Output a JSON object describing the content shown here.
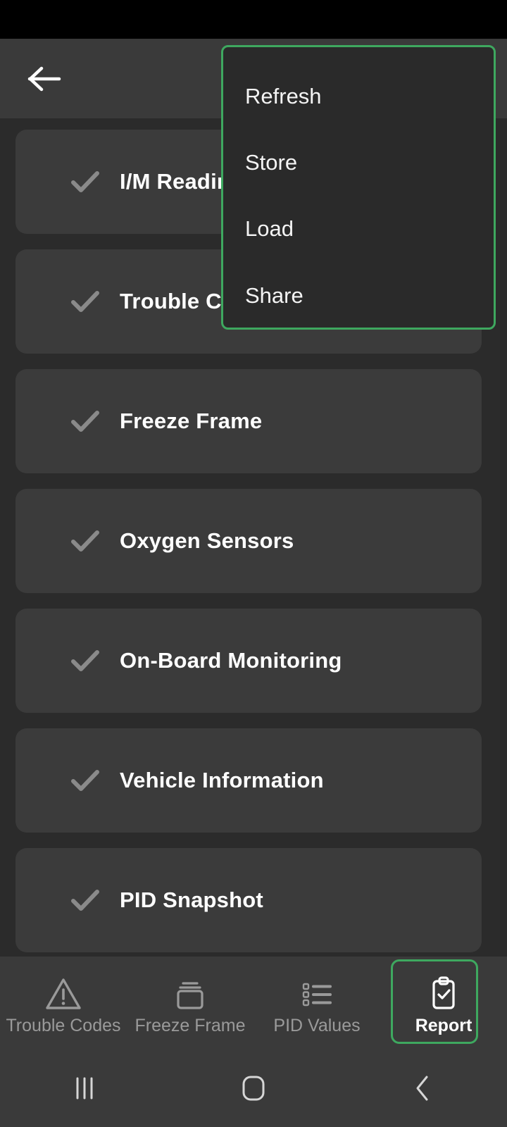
{
  "app_bar": {
    "back_icon": "arrow-left-icon"
  },
  "list": {
    "items": [
      {
        "label": "I/M Readiness",
        "check_icon": "check-icon",
        "checked": true
      },
      {
        "label": "Trouble Codes",
        "check_icon": "check-icon",
        "checked": true
      },
      {
        "label": "Freeze Frame",
        "check_icon": "check-icon",
        "checked": true
      },
      {
        "label": "Oxygen Sensors",
        "check_icon": "check-icon",
        "checked": true
      },
      {
        "label": "On-Board Monitoring",
        "check_icon": "check-icon",
        "checked": true
      },
      {
        "label": "Vehicle Information",
        "check_icon": "check-icon",
        "checked": true
      },
      {
        "label": "PID Snapshot",
        "check_icon": "check-icon",
        "checked": true
      }
    ]
  },
  "menu": {
    "items": [
      {
        "label": "Refresh"
      },
      {
        "label": "Store"
      },
      {
        "label": "Load"
      },
      {
        "label": "Share"
      }
    ],
    "border_color": "#3ea85f",
    "background_color": "#2a2a2a"
  },
  "tab_bar": {
    "tabs": [
      {
        "label": "Trouble Codes",
        "icon": "warning-triangle-icon",
        "active": false
      },
      {
        "label": "Freeze Frame",
        "icon": "layers-icon",
        "active": false
      },
      {
        "label": "PID Values",
        "icon": "list-icon",
        "active": false
      },
      {
        "label": "Report",
        "icon": "clipboard-check-icon",
        "active": true
      }
    ],
    "active_highlight_color": "#3ea85f"
  },
  "nav_bar": {
    "buttons": [
      {
        "name": "recents",
        "icon": "recents-bars-icon"
      },
      {
        "name": "home",
        "icon": "home-square-icon"
      },
      {
        "name": "back",
        "icon": "chevron-left-icon"
      }
    ]
  },
  "colors": {
    "page_background": "#2b2b2b",
    "card_background": "#3b3b3b",
    "bar_background": "#3a3a3a",
    "accent_green": "#3ea85f",
    "check_gray": "#8a8a8a",
    "label_white": "#ffffff",
    "tab_inactive": "#9a9a9a"
  }
}
